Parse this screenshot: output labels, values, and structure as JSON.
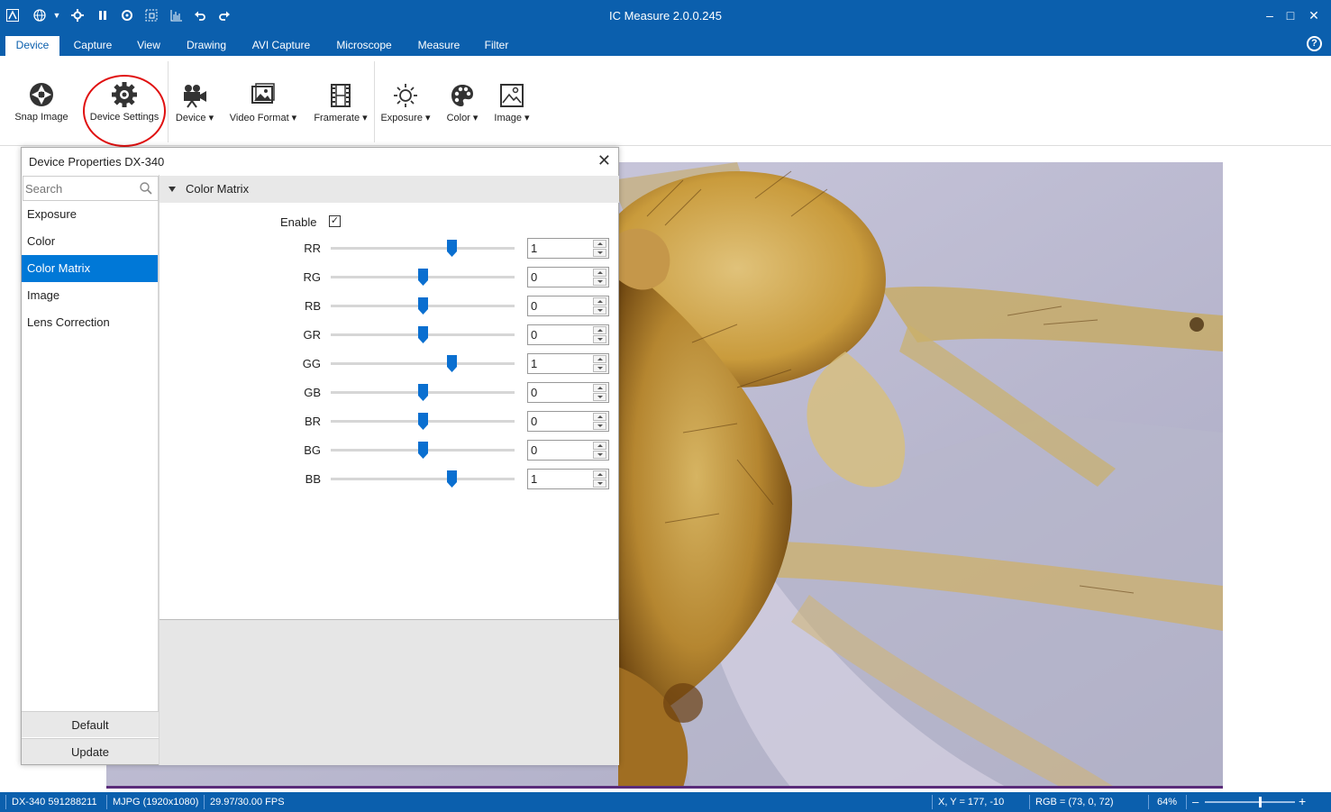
{
  "app": {
    "title": "IC Measure 2.0.0.245"
  },
  "quick_access": [
    "app-logo-icon",
    "globe-icon",
    "chevron-down-icon",
    "gear-icon",
    "pause-icon",
    "refresh-icon",
    "crop-icon",
    "histogram-icon",
    "undo-icon",
    "redo-icon"
  ],
  "window_controls": {
    "minimize": "–",
    "maximize": "□",
    "close": "✕"
  },
  "tabs": [
    {
      "label": "Device",
      "active": true
    },
    {
      "label": "Capture"
    },
    {
      "label": "View"
    },
    {
      "label": "Drawing"
    },
    {
      "label": "AVI Capture"
    },
    {
      "label": "Microscope"
    },
    {
      "label": "Measure"
    },
    {
      "label": "Filter"
    }
  ],
  "ribbon": {
    "snap_image": "Snap Image",
    "device_settings": "Device Settings",
    "device": "Device",
    "video_format": "Video Format",
    "framerate": "Framerate",
    "exposure": "Exposure",
    "color": "Color",
    "image": "Image"
  },
  "dialog": {
    "title": "Device Properties DX-340",
    "search_placeholder": "Search",
    "nav": [
      "Exposure",
      "Color",
      "Color Matrix",
      "Image",
      "Lens Correction"
    ],
    "selected_nav": "Color Matrix",
    "default_button": "Default",
    "update_button": "Update",
    "section_title": "Color Matrix",
    "enable_label": "Enable",
    "enable_checked": true,
    "matrix": [
      {
        "label": "RR",
        "value": "1",
        "slider": 0.66
      },
      {
        "label": "RG",
        "value": "0",
        "slider": 0.5
      },
      {
        "label": "RB",
        "value": "0",
        "slider": 0.5
      },
      {
        "label": "GR",
        "value": "0",
        "slider": 0.5
      },
      {
        "label": "GG",
        "value": "1",
        "slider": 0.66
      },
      {
        "label": "GB",
        "value": "0",
        "slider": 0.5
      },
      {
        "label": "BR",
        "value": "0",
        "slider": 0.5
      },
      {
        "label": "BG",
        "value": "0",
        "slider": 0.5
      },
      {
        "label": "BB",
        "value": "1",
        "slider": 0.66
      }
    ]
  },
  "status": {
    "device": "DX-340  591288211",
    "format": "MJPG (1920x1080)",
    "fps": "29.97/30.00 FPS",
    "coords": "X, Y = 177, -10",
    "rgb": "RGB = (73, 0, 72)",
    "zoom": "64%",
    "zoom_minus": "–",
    "zoom_plus": "+",
    "zoom_level": 0.6
  },
  "colors": {
    "accent": "#0b5fad",
    "selection": "#0078d7",
    "slider_thumb": "#0a6fd0",
    "highlight_circle": "#e01010"
  }
}
